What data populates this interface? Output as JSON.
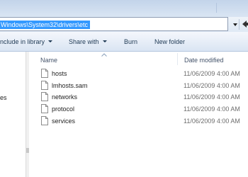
{
  "address": {
    "path": "Windows\\System32\\drivers\\etc"
  },
  "toolbar": {
    "include_library": "nclude in library",
    "share_with": "Share with",
    "burn": "Burn",
    "new_folder": "New folder"
  },
  "nav": {
    "partial_label": "es"
  },
  "columns": {
    "name": "Name",
    "date_modified": "Date modified"
  },
  "files": [
    {
      "name": "hosts",
      "date": "11/06/2009 4:00 AM"
    },
    {
      "name": "lmhosts.sam",
      "date": "11/06/2009 4:00 AM"
    },
    {
      "name": "networks",
      "date": "11/06/2009 4:00 AM"
    },
    {
      "name": "protocol",
      "date": "11/06/2009 4:00 AM"
    },
    {
      "name": "services",
      "date": "11/06/2009 4:00 AM"
    }
  ],
  "colors": {
    "selection": "#3399ff",
    "toolbar_text": "#1e3954",
    "header_text": "#44536a"
  }
}
